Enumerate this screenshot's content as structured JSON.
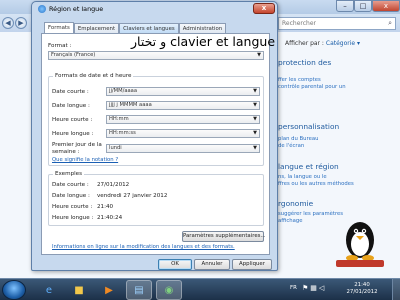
{
  "control_panel": {
    "search_placeholder": "Rechercher",
    "view_label": "Afficher par :",
    "view_value": "Catégorie ▾",
    "sections": [
      {
        "heading": "protection des",
        "links": [
          "ffer les comptes",
          "contrôle parental pour un"
        ]
      },
      {
        "heading": "personnalisation",
        "links": [
          "plan du Bureau",
          "de l'écran"
        ]
      },
      {
        "heading": "langue et région",
        "links": [
          "ns, la langue ou le",
          "ffres ou les autres méthodes"
        ]
      },
      {
        "heading": "rgonomie",
        "links": [
          "suggérer les paramètres",
          "affichage"
        ]
      }
    ]
  },
  "dialog": {
    "title": "Région et langue",
    "close_label": "x",
    "tabs": [
      "Formats",
      "Emplacement",
      "Claviers et langues",
      "Administration"
    ],
    "watermark_text": "و تختار clavier et langue",
    "format_label": "Format :",
    "format_value": "Français (France)",
    "date_group_title": "Formats de date et d heure",
    "fields": [
      {
        "label": "Date courte :",
        "value": "jj/MM/aaaa"
      },
      {
        "label": "Date longue :",
        "value": "jjjj j MMMM aaaa"
      },
      {
        "label": "Heure courte :",
        "value": "HH:mm"
      },
      {
        "label": "Heure longue :",
        "value": "HH:mm:ss"
      },
      {
        "label": "Premier jour de la semaine :",
        "value": "lundi"
      }
    ],
    "notation_link": "Que signifie la notation ?",
    "examples_title": "Exemples",
    "examples": [
      {
        "label": "Date courte :",
        "value": "27/01/2012"
      },
      {
        "label": "Date longue :",
        "value": "vendredi 27 janvier 2012"
      },
      {
        "label": "Heure courte :",
        "value": "21:40"
      },
      {
        "label": "Heure longue :",
        "value": "21:40:24"
      }
    ],
    "more_settings_button": "Paramètres supplémentaires...",
    "online_link": "Informations en ligne sur la modification des langues et des formats.",
    "ok_button": "OK",
    "cancel_button": "Annuler",
    "apply_button": "Appliquer"
  },
  "taskbar": {
    "language": "FR",
    "time": "21:40",
    "date": "27/01/2012"
  }
}
